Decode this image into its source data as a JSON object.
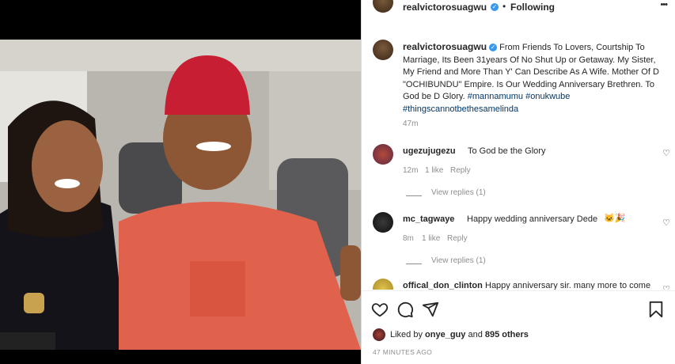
{
  "header": {
    "username": "realvictorosuagwu",
    "separator": "•",
    "follow_status": "Following",
    "more": "•••"
  },
  "caption": {
    "username": "realvictorosuagwu",
    "text": "From Friends To Lovers, Courtship To Marriage, Its Been 31years Of No Shut Up or Getaway. My Sister, My Friend and More Than Y' Can Describe As A Wife. Mother Of D \"OCHIBUNDU\" Empire. Is Our Wedding Anniversary Brethren. To God be D Glory.",
    "hashtags": [
      "#mannamumu",
      "#onukwube",
      "#thingscannotbethesamelinda"
    ],
    "time": "47m"
  },
  "comments": [
    {
      "username": "ugezujugezu",
      "text": "To God be the Glory",
      "time": "12m",
      "likes": "1 like",
      "reply": "Reply",
      "view_replies": "View replies (1)",
      "emoji": ""
    },
    {
      "username": "mc_tagwaye",
      "text": "Happy wedding anniversary Dede",
      "time": "8m",
      "likes": "1 like",
      "reply": "Reply",
      "view_replies": "View replies (1)",
      "emoji": "🐱🎉"
    },
    {
      "username": "offical_don_clinton",
      "text": "Happy anniversary sir. many more to come"
    }
  ],
  "likes": {
    "prefix": "Liked by",
    "user": "onye_guy",
    "joiner": "and",
    "others": "895 others"
  },
  "timestamp": "47 MINUTES AGO",
  "icons": {
    "like": "heart-icon",
    "comment": "comment-icon",
    "share": "share-icon",
    "save": "bookmark-icon"
  }
}
